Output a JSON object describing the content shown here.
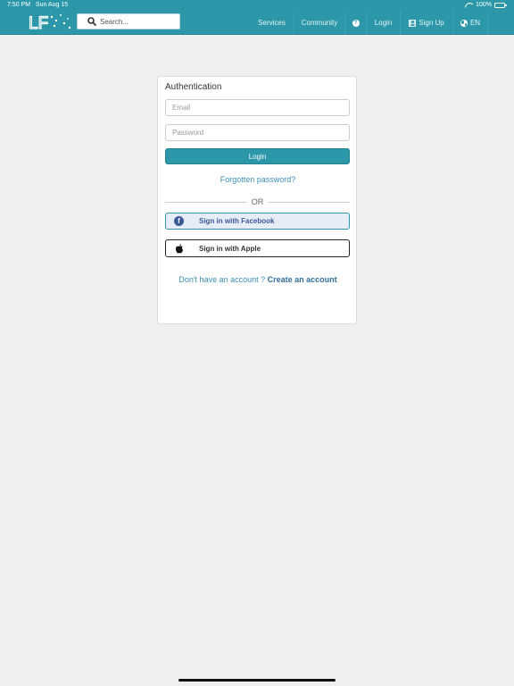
{
  "status_bar": {
    "time": "7:50 PM",
    "date": "Sun Aug 15",
    "battery": "100%"
  },
  "navbar": {
    "logo_text": "LF",
    "search_placeholder": "Search...",
    "items": {
      "services": "Services",
      "community": "Community",
      "help_icon": "question-circle-icon",
      "login": "Login",
      "signup": "Sign Up",
      "language": "EN"
    }
  },
  "auth": {
    "title": "Authentication",
    "email_placeholder": "Email",
    "password_placeholder": "Password",
    "login_button": "Login",
    "forgot_password": "Forgotten password?",
    "or_separator": "OR",
    "facebook_button": "Sign in with Facebook",
    "apple_button": "Sign in with Apple",
    "no_account_text": "Don't have an account ?",
    "create_account": "Create an account"
  },
  "colors": {
    "brand": "#2b97a8",
    "facebook": "#3b5998",
    "link": "#3a8fb5",
    "background": "#efefef"
  }
}
